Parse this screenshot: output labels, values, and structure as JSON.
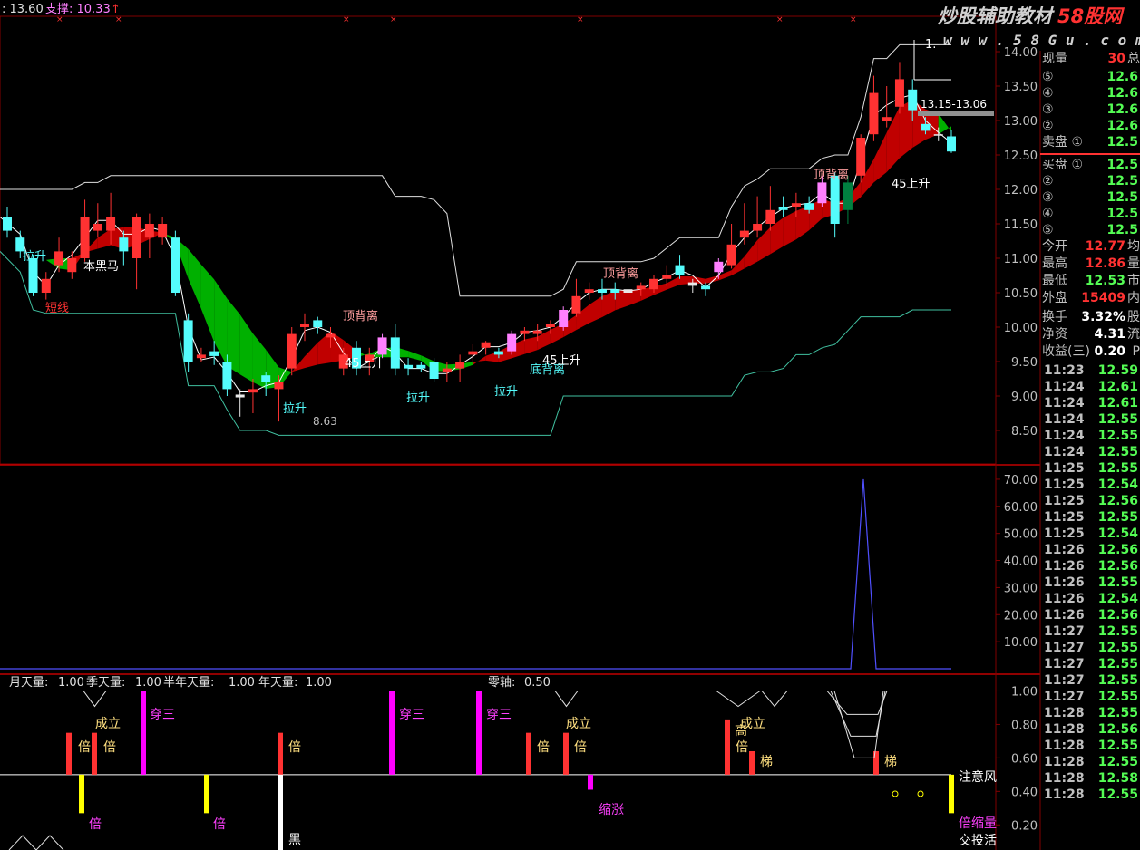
{
  "header": {
    "text1": ": 13.60",
    "text2": "支撑: 10.33",
    "arrow": "↑"
  },
  "watermark": {
    "brand": "炒股辅助教材",
    "site_name": "58股网",
    "url": "w w w . 5 8 G u . c o m"
  },
  "chart_data": {
    "type": "candlestick",
    "price_axis": {
      "ticks": [
        "14.00",
        "13.50",
        "13.00",
        "12.50",
        "12.00",
        "11.50",
        "11.00",
        "10.50",
        "10.00",
        "9.50",
        "9.00",
        "8.50"
      ],
      "range": [
        8.3,
        14.1
      ]
    },
    "candles": [
      {
        "o": 11.4,
        "c": 11.6,
        "h": 11.75,
        "l": 11.3,
        "color": "cyan"
      },
      {
        "o": 11.3,
        "c": 11.1,
        "h": 11.4,
        "l": 11.0,
        "color": "cyan"
      },
      {
        "o": 11.0,
        "c": 10.5,
        "h": 11.05,
        "l": 10.45,
        "color": "cyan"
      },
      {
        "o": 10.5,
        "c": 10.7,
        "h": 10.8,
        "l": 10.4,
        "color": "red"
      },
      {
        "o": 10.9,
        "c": 11.1,
        "h": 11.3,
        "l": 10.8,
        "color": "red"
      },
      {
        "o": 10.8,
        "c": 11.0,
        "h": 11.1,
        "l": 10.7,
        "color": "red"
      },
      {
        "o": 11.0,
        "c": 11.6,
        "h": 11.85,
        "l": 10.95,
        "color": "red"
      },
      {
        "o": 11.4,
        "c": 11.5,
        "h": 11.8,
        "l": 11.3,
        "color": "red"
      },
      {
        "o": 11.4,
        "c": 11.6,
        "h": 11.95,
        "l": 11.2,
        "color": "red"
      },
      {
        "o": 11.3,
        "c": 11.1,
        "h": 11.4,
        "l": 10.9,
        "color": "cyan"
      },
      {
        "o": 11.0,
        "c": 11.6,
        "h": 11.65,
        "l": 10.55,
        "color": "red"
      },
      {
        "o": 11.5,
        "c": 11.3,
        "h": 11.65,
        "l": 11.0,
        "color": "red"
      },
      {
        "o": 11.3,
        "c": 11.5,
        "h": 11.6,
        "l": 11.2,
        "color": "red"
      },
      {
        "o": 11.3,
        "c": 10.5,
        "h": 11.4,
        "l": 10.45,
        "color": "cyan"
      },
      {
        "o": 10.1,
        "c": 9.5,
        "h": 10.2,
        "l": 9.35,
        "color": "cyan"
      },
      {
        "o": 9.6,
        "c": 9.55,
        "h": 9.7,
        "l": 9.5,
        "color": "red"
      },
      {
        "o": 9.65,
        "c": 9.58,
        "h": 9.8,
        "l": 9.45,
        "color": "cyan"
      },
      {
        "o": 9.5,
        "c": 9.1,
        "h": 9.6,
        "l": 9.0,
        "color": "cyan"
      },
      {
        "o": 8.98,
        "c": 9.02,
        "h": 9.1,
        "l": 8.7,
        "color": "white"
      },
      {
        "o": 9.05,
        "c": 9.1,
        "h": 9.25,
        "l": 8.75,
        "color": "red"
      },
      {
        "o": 9.3,
        "c": 9.2,
        "h": 9.35,
        "l": 9.0,
        "color": "cyan"
      },
      {
        "o": 9.1,
        "c": 9.2,
        "h": 9.3,
        "l": 8.63,
        "color": "red"
      },
      {
        "o": 9.4,
        "c": 9.9,
        "h": 10.0,
        "l": 9.3,
        "color": "red"
      },
      {
        "o": 10.05,
        "c": 10.0,
        "h": 10.2,
        "l": 9.8,
        "color": "red"
      },
      {
        "o": 10.1,
        "c": 10.0,
        "h": 10.15,
        "l": 9.9,
        "color": "cyan"
      },
      {
        "o": 9.9,
        "c": 9.85,
        "h": 10.0,
        "l": 9.7,
        "color": "red"
      },
      {
        "o": 9.6,
        "c": 9.4,
        "h": 9.7,
        "l": 9.3,
        "color": "red"
      },
      {
        "o": 9.7,
        "c": 9.4,
        "h": 9.8,
        "l": 9.3,
        "color": "cyan"
      },
      {
        "o": 9.5,
        "c": 9.6,
        "h": 9.7,
        "l": 9.3,
        "color": "red"
      },
      {
        "o": 9.6,
        "c": 9.85,
        "h": 9.9,
        "l": 9.55,
        "color": "pink"
      },
      {
        "o": 9.85,
        "c": 9.4,
        "h": 10.05,
        "l": 9.3,
        "color": "cyan"
      },
      {
        "o": 9.45,
        "c": 9.4,
        "h": 9.55,
        "l": 9.3,
        "color": "cyan"
      },
      {
        "o": 9.45,
        "c": 9.4,
        "h": 9.5,
        "l": 9.35,
        "color": "cyan"
      },
      {
        "o": 9.5,
        "c": 9.25,
        "h": 9.55,
        "l": 9.2,
        "color": "cyan"
      },
      {
        "o": 9.35,
        "c": 9.4,
        "h": 9.5,
        "l": 9.2,
        "color": "red"
      },
      {
        "o": 9.4,
        "c": 9.5,
        "h": 9.6,
        "l": 9.2,
        "color": "red"
      },
      {
        "o": 9.6,
        "c": 9.65,
        "h": 9.75,
        "l": 9.5,
        "color": "red"
      },
      {
        "o": 9.7,
        "c": 9.78,
        "h": 9.8,
        "l": 9.6,
        "color": "red"
      },
      {
        "o": 9.6,
        "c": 9.65,
        "h": 9.7,
        "l": 9.55,
        "color": "cyan"
      },
      {
        "o": 9.65,
        "c": 9.9,
        "h": 9.95,
        "l": 9.6,
        "color": "pink"
      },
      {
        "o": 9.9,
        "c": 9.95,
        "h": 10.0,
        "l": 9.8,
        "color": "red"
      },
      {
        "o": 9.9,
        "c": 9.95,
        "h": 10.05,
        "l": 9.8,
        "color": "red"
      },
      {
        "o": 10.0,
        "c": 10.05,
        "h": 10.1,
        "l": 9.9,
        "color": "red"
      },
      {
        "o": 10.0,
        "c": 10.25,
        "h": 10.3,
        "l": 9.95,
        "color": "pink"
      },
      {
        "o": 10.2,
        "c": 10.45,
        "h": 10.7,
        "l": 10.15,
        "color": "red"
      },
      {
        "o": 10.5,
        "c": 10.55,
        "h": 10.65,
        "l": 10.4,
        "color": "red"
      },
      {
        "o": 10.5,
        "c": 10.55,
        "h": 10.7,
        "l": 10.4,
        "color": "cyan"
      },
      {
        "o": 10.5,
        "c": 10.55,
        "h": 10.65,
        "l": 10.4,
        "color": "cyan"
      },
      {
        "o": 10.55,
        "c": 10.5,
        "h": 10.65,
        "l": 10.35,
        "color": "white"
      },
      {
        "o": 10.55,
        "c": 10.6,
        "h": 10.65,
        "l": 10.45,
        "color": "red"
      },
      {
        "o": 10.55,
        "c": 10.7,
        "h": 10.75,
        "l": 10.5,
        "color": "red"
      },
      {
        "o": 10.7,
        "c": 10.75,
        "h": 10.9,
        "l": 10.6,
        "color": "red"
      },
      {
        "o": 10.75,
        "c": 10.9,
        "h": 11.05,
        "l": 10.7,
        "color": "cyan"
      },
      {
        "o": 10.65,
        "c": 10.6,
        "h": 10.7,
        "l": 10.5,
        "color": "white"
      },
      {
        "o": 10.6,
        "c": 10.55,
        "h": 10.65,
        "l": 10.45,
        "color": "cyan"
      },
      {
        "o": 10.8,
        "c": 10.95,
        "h": 11.0,
        "l": 10.7,
        "color": "pink"
      },
      {
        "o": 10.9,
        "c": 11.2,
        "h": 11.5,
        "l": 10.85,
        "color": "red"
      },
      {
        "o": 11.3,
        "c": 11.4,
        "h": 11.8,
        "l": 11.2,
        "color": "red"
      },
      {
        "o": 11.4,
        "c": 11.5,
        "h": 11.9,
        "l": 11.3,
        "color": "red"
      },
      {
        "o": 11.5,
        "c": 11.7,
        "h": 12.05,
        "l": 11.4,
        "color": "red"
      },
      {
        "o": 11.7,
        "c": 11.75,
        "h": 11.9,
        "l": 11.6,
        "color": "cyan"
      },
      {
        "o": 11.75,
        "c": 11.8,
        "h": 11.95,
        "l": 11.6,
        "color": "red"
      },
      {
        "o": 11.7,
        "c": 11.8,
        "h": 11.9,
        "l": 11.65,
        "color": "cyan"
      },
      {
        "o": 11.8,
        "c": 12.1,
        "h": 12.2,
        "l": 11.75,
        "color": "pink"
      },
      {
        "o": 12.2,
        "c": 11.5,
        "h": 12.25,
        "l": 11.3,
        "color": "cyan"
      },
      {
        "o": 11.7,
        "c": 12.1,
        "h": 12.2,
        "l": 11.5,
        "color": "green"
      },
      {
        "o": 12.2,
        "c": 12.75,
        "h": 12.8,
        "l": 12.1,
        "color": "red"
      },
      {
        "o": 12.8,
        "c": 13.4,
        "h": 13.65,
        "l": 12.7,
        "color": "red"
      },
      {
        "o": 13.0,
        "c": 13.05,
        "h": 13.5,
        "l": 12.9,
        "color": "red"
      },
      {
        "o": 13.2,
        "c": 13.6,
        "h": 13.85,
        "l": 13.1,
        "color": "red"
      },
      {
        "o": 13.45,
        "c": 13.15,
        "h": 13.6,
        "l": 13.0,
        "color": "cyan"
      },
      {
        "o": 12.95,
        "c": 12.85,
        "h": 13.05,
        "l": 12.8,
        "color": "cyan"
      },
      {
        "o": 12.78,
        "c": 12.8,
        "h": 12.9,
        "l": 12.7,
        "color": "white"
      },
      {
        "o": 12.77,
        "c": 12.55,
        "h": 12.86,
        "l": 12.53,
        "color": "cyan"
      }
    ],
    "price_annotations": [
      "拉升",
      "本黑马",
      "短线",
      "顶背离",
      "拉升",
      "拉升",
      "拉升",
      "底背离",
      "45上升",
      "顶背离",
      "顶背离",
      "45上升",
      "45上升",
      "13.15-13.06",
      "1.",
      "8.63"
    ],
    "volume_axis": {
      "ticks": [
        "70.00",
        "60.00",
        "50.00",
        "40.00",
        "30.00",
        "20.00",
        "10.00"
      ],
      "range": [
        0,
        75
      ]
    },
    "volume_series": [
      {
        "values": [
          0,
          0,
          70,
          0,
          0
        ]
      }
    ],
    "indicator_header": {
      "labels": [
        "月天量:",
        "季天量:",
        "半年天量:",
        "年天量:"
      ],
      "values": [
        "1.00",
        "1.00",
        "1.00",
        "1.00"
      ],
      "zero_label": "零轴:",
      "zero_value": "0.50"
    },
    "indicator_axis": {
      "ticks": [
        "1.00",
        "0.80",
        "0.60",
        "0.40",
        "0.20"
      ],
      "range": [
        0.05,
        1.1
      ]
    },
    "indicator_labels": [
      "成立",
      "穿三",
      "倍",
      "倍",
      "穿三",
      "倍",
      "穿三",
      "倍",
      "倍",
      "成立",
      "高",
      "倍",
      "成立",
      "梯",
      "梯",
      "倍",
      "倍",
      "黑",
      "缩涨",
      "注意风",
      "倍缩量",
      "交投活"
    ]
  },
  "quote": {
    "current_vol_label": "现量",
    "current_vol_value": "30",
    "current_vol_suffix": "总",
    "sell_levels": [
      {
        "label": "⑤",
        "price": "12.6"
      },
      {
        "label": "④",
        "price": "12.6"
      },
      {
        "label": "③",
        "price": "12.6"
      },
      {
        "label": "②",
        "price": "12.6"
      },
      {
        "label": "卖盘 ①",
        "price": "12.5"
      }
    ],
    "buy_levels": [
      {
        "label": "买盘 ①",
        "price": "12.5"
      },
      {
        "label": "②",
        "price": "12.5"
      },
      {
        "label": "③",
        "price": "12.5"
      },
      {
        "label": "④",
        "price": "12.5"
      },
      {
        "label": "⑤",
        "price": "12.5"
      }
    ],
    "stats": [
      {
        "label": "今开",
        "value": "12.77",
        "suffix": "均"
      },
      {
        "label": "最高",
        "value": "12.86",
        "suffix": "量"
      },
      {
        "label": "最低",
        "value": "12.53",
        "suffix": "市"
      },
      {
        "label": "外盘",
        "value": "15409",
        "suffix": "内"
      },
      {
        "label": "换手",
        "value": "3.32%",
        "suffix": "股"
      },
      {
        "label": "净资",
        "value": "4.31",
        "suffix": "流"
      },
      {
        "label": "收益(三)",
        "value": "0.20",
        "suffix": "P"
      }
    ],
    "ticks": [
      {
        "time": "11:23",
        "price": "12.59"
      },
      {
        "time": "11:24",
        "price": "12.61"
      },
      {
        "time": "11:24",
        "price": "12.61"
      },
      {
        "time": "11:24",
        "price": "12.55"
      },
      {
        "time": "11:24",
        "price": "12.55"
      },
      {
        "time": "11:24",
        "price": "12.55"
      },
      {
        "time": "11:25",
        "price": "12.55"
      },
      {
        "time": "11:25",
        "price": "12.54"
      },
      {
        "time": "11:25",
        "price": "12.56"
      },
      {
        "time": "11:25",
        "price": "12.55"
      },
      {
        "time": "11:25",
        "price": "12.54"
      },
      {
        "time": "11:26",
        "price": "12.56"
      },
      {
        "time": "11:26",
        "price": "12.56"
      },
      {
        "time": "11:26",
        "price": "12.55"
      },
      {
        "time": "11:26",
        "price": "12.54"
      },
      {
        "time": "11:26",
        "price": "12.56"
      },
      {
        "time": "11:27",
        "price": "12.55"
      },
      {
        "time": "11:27",
        "price": "12.55"
      },
      {
        "time": "11:27",
        "price": "12.55"
      },
      {
        "time": "11:27",
        "price": "12.55"
      },
      {
        "time": "11:27",
        "price": "12.55"
      },
      {
        "time": "11:28",
        "price": "12.55"
      },
      {
        "time": "11:28",
        "price": "12.56"
      },
      {
        "time": "11:28",
        "price": "12.55"
      },
      {
        "time": "11:28",
        "price": "12.55"
      },
      {
        "time": "11:28",
        "price": "12.58"
      },
      {
        "time": "11:28",
        "price": "12.55"
      }
    ]
  },
  "colors": {
    "up": "#ff3232",
    "down": "#54fcfc",
    "pink": "#ff80ff",
    "green_cloud": "#00b000",
    "red_cloud": "#c00000",
    "magenta": "#ff00ff",
    "yellow": "#ffff00",
    "grid": "#800000"
  }
}
